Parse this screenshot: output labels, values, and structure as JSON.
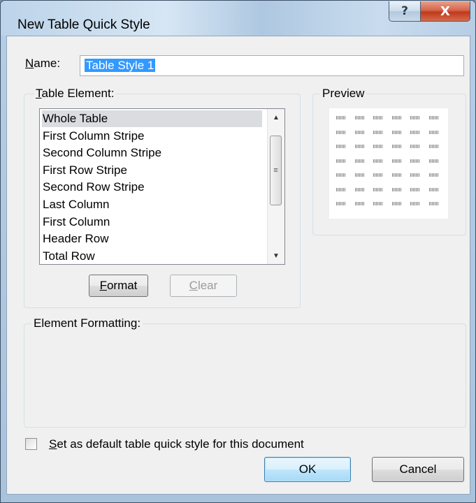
{
  "dialog": {
    "title": "New Table Quick Style",
    "help_glyph": "?",
    "close_glyph": "X",
    "icons": {
      "help": "question-mark-icon",
      "close": "close-x-icon"
    }
  },
  "name": {
    "label": "Name:",
    "value": "Table Style 1"
  },
  "table_element": {
    "legend": "Table Element:",
    "items": [
      "Whole Table",
      "First Column Stripe",
      "Second Column Stripe",
      "First Row Stripe",
      "Second Row Stripe",
      "Last Column",
      "First Column",
      "Header Row",
      "Total Row"
    ],
    "selected": "Whole Table",
    "format_button": "Format",
    "clear_button": "Clear"
  },
  "preview": {
    "legend": "Preview",
    "rows": 7,
    "columns": 6
  },
  "element_formatting": {
    "legend": "Element Formatting:"
  },
  "default_checkbox": {
    "label": "Set as default table quick style for this document",
    "checked": false
  },
  "buttons": {
    "ok": "OK",
    "cancel": "Cancel"
  },
  "colors": {
    "selection": "#3399ff",
    "close_button": "#c0391d",
    "dialog_background": "#f0f0f0"
  }
}
